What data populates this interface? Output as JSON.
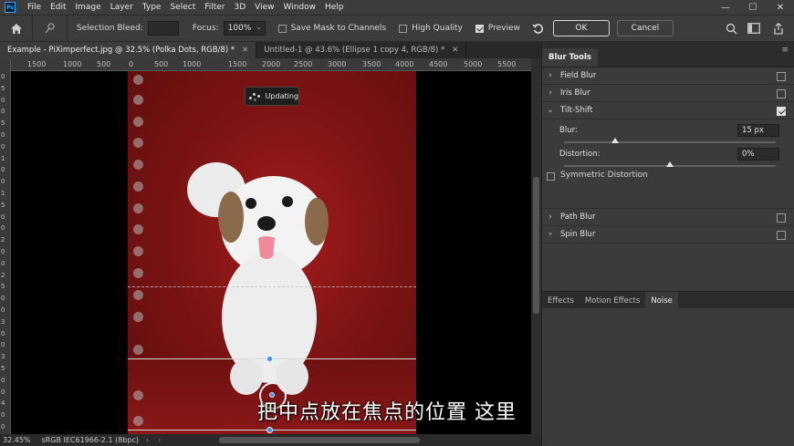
{
  "app": {
    "logo": "Ps"
  },
  "menu": [
    "File",
    "Edit",
    "Image",
    "Layer",
    "Type",
    "Select",
    "Filter",
    "3D",
    "View",
    "Window",
    "Help"
  ],
  "window_controls": {
    "minimize": "—",
    "maximize": "☐",
    "close": "✕"
  },
  "options": {
    "selection_bleed_label": "Selection Bleed:",
    "selection_bleed_value": "",
    "focus_label": "Focus:",
    "focus_value": "100%",
    "save_mask_label": "Save Mask to Channels",
    "save_mask_checked": false,
    "high_quality_label": "High Quality",
    "high_quality_checked": false,
    "preview_label": "Preview",
    "preview_checked": true,
    "ok_label": "OK",
    "cancel_label": "Cancel"
  },
  "tabs": [
    {
      "label": "Example - PiXimperfect.jpg @ 32.5% (Polka Dots, RGB/8) *",
      "active": true
    },
    {
      "label": "Untitled-1 @ 43.6% (Ellipse 1 copy 4, RGB/8) *",
      "active": false
    }
  ],
  "ruler_h": [
    "1500",
    "1000",
    "500",
    "0",
    "500",
    "1000",
    "1500",
    "2000",
    "2500",
    "3000",
    "3500",
    "4000",
    "4500",
    "5000",
    "5500"
  ],
  "ruler_v": [
    "0",
    "5",
    "0",
    "0",
    "5",
    "0",
    "0",
    "1",
    "0",
    "0",
    "1",
    "5",
    "0",
    "0",
    "2",
    "0",
    "0",
    "2",
    "5",
    "0",
    "0",
    "3",
    "0",
    "0",
    "3",
    "5",
    "0",
    "0",
    "4",
    "0",
    "0"
  ],
  "canvas": {
    "updating_label": "Updating",
    "subtitle": "把中点放在焦点的位置  这里"
  },
  "status": {
    "zoom": "32.45%",
    "profile": "sRGB IEC61966-2.1 (8bpc)"
  },
  "panel": {
    "title": "Blur Tools",
    "sections": [
      {
        "label": "Field Blur",
        "expanded": false,
        "checked": false
      },
      {
        "label": "Iris Blur",
        "expanded": false,
        "checked": false
      },
      {
        "label": "Tilt-Shift",
        "expanded": true,
        "checked": true
      },
      {
        "label": "Path Blur",
        "expanded": false,
        "checked": false
      },
      {
        "label": "Spin Blur",
        "expanded": false,
        "checked": false
      }
    ],
    "tilt": {
      "blur_label": "Blur:",
      "blur_value": "15 px",
      "blur_slider": 0.24,
      "distortion_label": "Distortion:",
      "distortion_value": "0%",
      "distortion_slider": 0.5,
      "symmetric_label": "Symmetric Distortion",
      "symmetric_checked": false
    },
    "effects_tabs": [
      {
        "label": "Effects",
        "active": false
      },
      {
        "label": "Motion Effects",
        "active": false
      },
      {
        "label": "Noise",
        "active": true
      }
    ]
  }
}
